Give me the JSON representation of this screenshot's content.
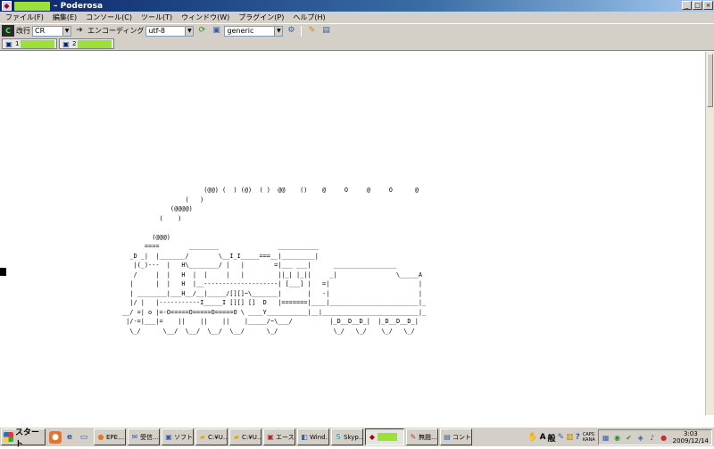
{
  "window": {
    "title": "– Poderosa",
    "controls": [
      "minimize",
      "maximize",
      "close"
    ]
  },
  "menu": {
    "items": [
      {
        "id": "file",
        "label": "ファイル(F)"
      },
      {
        "id": "edit",
        "label": "編集(E)"
      },
      {
        "id": "console",
        "label": "コンソール(C)"
      },
      {
        "id": "tools",
        "label": "ツール(T)"
      },
      {
        "id": "window",
        "label": "ウィンドウ(W)"
      },
      {
        "id": "plugins",
        "label": "プラグイン(P)"
      },
      {
        "id": "help",
        "label": "ヘルプ(H)"
      }
    ]
  },
  "toolbar": {
    "newline_label": "改行",
    "newline_value": "CR",
    "encoding_label": "エンコーディング",
    "encoding_value": "utf-8",
    "terminal_type_value": "generic"
  },
  "tabs": [
    {
      "number": "1",
      "color": "#9ee03a"
    },
    {
      "number": "2",
      "color": "#9ee03a"
    }
  ],
  "terminal": {
    "ascii_art": "                      (@@) (  ) (@)  ( )  @@    ()    @     O     @     O      @\n                 (   )\n             (@@@@)\n          (    )\n\n        (@@@)\n      ====        ________                ___________\n  _D _|  |_______/        \\__I_I_____===__|_________|\n   |(_)---  |   H\\________/ |   |        =|___ ___|      _________________\n   /     |  |   H  |  |     |   |         ||_| |_||     _|                \\_____A\n  |      |  |   H  |__--------------------| [___] |   =|                        |\n  | ________|___H__/__|_____/[][]~\\_______|       |   -|                        |\n  |/ |   |-----------I_____I [][] []  D   |=======|____|________________________|_\n__/ =| o |=-O=====O=====O=====O \\ ____Y___________|__|__________________________|_\n |/-=|___|=    ||    ||    ||    |_____/~\\___/          |_D__D__D_|  |_D__D__D_|\n  \\_/      \\__/  \\__/  \\__/  \\__/      \\_/               \\_/   \\_/    \\_/   \\_/"
  },
  "taskbar": {
    "start_label": "スタート",
    "quick_launch": [
      "firefox-icon",
      "ie-icon",
      "desktop-icon"
    ],
    "tasks": [
      {
        "label": "EPE…",
        "icon": "firefox-icon"
      },
      {
        "label": "受信…",
        "icon": "mail-icon"
      },
      {
        "label": "ソフト…",
        "icon": "app-icon"
      },
      {
        "label": "C:¥U…",
        "icon": "folder-icon"
      },
      {
        "label": "C:¥U…",
        "icon": "folder-icon"
      },
      {
        "label": "エース…",
        "icon": "app-icon"
      },
      {
        "label": "Wind…",
        "icon": "window-icon"
      },
      {
        "label": "Skyp…",
        "icon": "skype-icon"
      },
      {
        "label": "",
        "icon": "poderosa-icon",
        "active": true
      },
      {
        "label": "無題…",
        "icon": "notepad-icon"
      },
      {
        "label": "コント…",
        "icon": "control-icon"
      }
    ],
    "ime": {
      "a": "A",
      "mode": "般"
    },
    "caps": "CAPS",
    "kana": "KANA",
    "clock": {
      "time": "3:03",
      "date": "2009/12/14"
    }
  }
}
